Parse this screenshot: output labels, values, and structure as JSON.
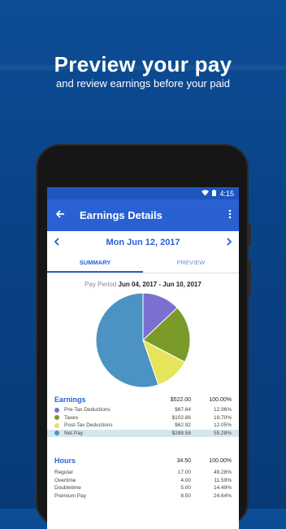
{
  "promo": {
    "headline": "Preview your pay",
    "subheadline": "and review earnings before your paid"
  },
  "status_bar": {
    "time": "4:15"
  },
  "app_bar": {
    "title": "Earnings Details"
  },
  "date_nav": {
    "date": "Mon Jun 12, 2017"
  },
  "tabs": [
    {
      "label": "SUMMARY",
      "active": true
    },
    {
      "label": "PREVIEW",
      "active": false
    }
  ],
  "pay_period": {
    "label": "Pay Period",
    "range": "Jun 04, 2017 - Jun 10, 2017"
  },
  "earnings": {
    "title": "Earnings",
    "total": "$522.00",
    "total_pct": "100.00%",
    "rows": [
      {
        "label": "Pre-Tax Deductions",
        "amount": "$67.64",
        "pct": "12.96%",
        "color": "#7b6fd0"
      },
      {
        "label": "Taxes",
        "amount": "$102.86",
        "pct": "19.70%",
        "color": "#7a9a2a"
      },
      {
        "label": "Post-Tax Deductions",
        "amount": "$62.92",
        "pct": "12.05%",
        "color": "#e6e45a"
      },
      {
        "label": "Net Pay",
        "amount": "$288.58",
        "pct": "55.28%",
        "color": "#4a93c2"
      }
    ]
  },
  "hours": {
    "title": "Hours",
    "total": "34.50",
    "total_pct": "100.00%",
    "rows": [
      {
        "label": "Regular",
        "amount": "17.00",
        "pct": "49.28%"
      },
      {
        "label": "Overtime",
        "amount": "4.00",
        "pct": "11.59%"
      },
      {
        "label": "Doubletime",
        "amount": "5.00",
        "pct": "14.49%"
      },
      {
        "label": "Premium Pay",
        "amount": "8.50",
        "pct": "24.64%"
      }
    ]
  },
  "chart_data": {
    "type": "pie",
    "categories": [
      "Pre-Tax Deductions",
      "Taxes",
      "Post-Tax Deductions",
      "Net Pay"
    ],
    "values": [
      12.96,
      19.7,
      12.05,
      55.28
    ],
    "colors": [
      "#7b6fd0",
      "#7a9a2a",
      "#e6e45a",
      "#4a93c2"
    ]
  }
}
